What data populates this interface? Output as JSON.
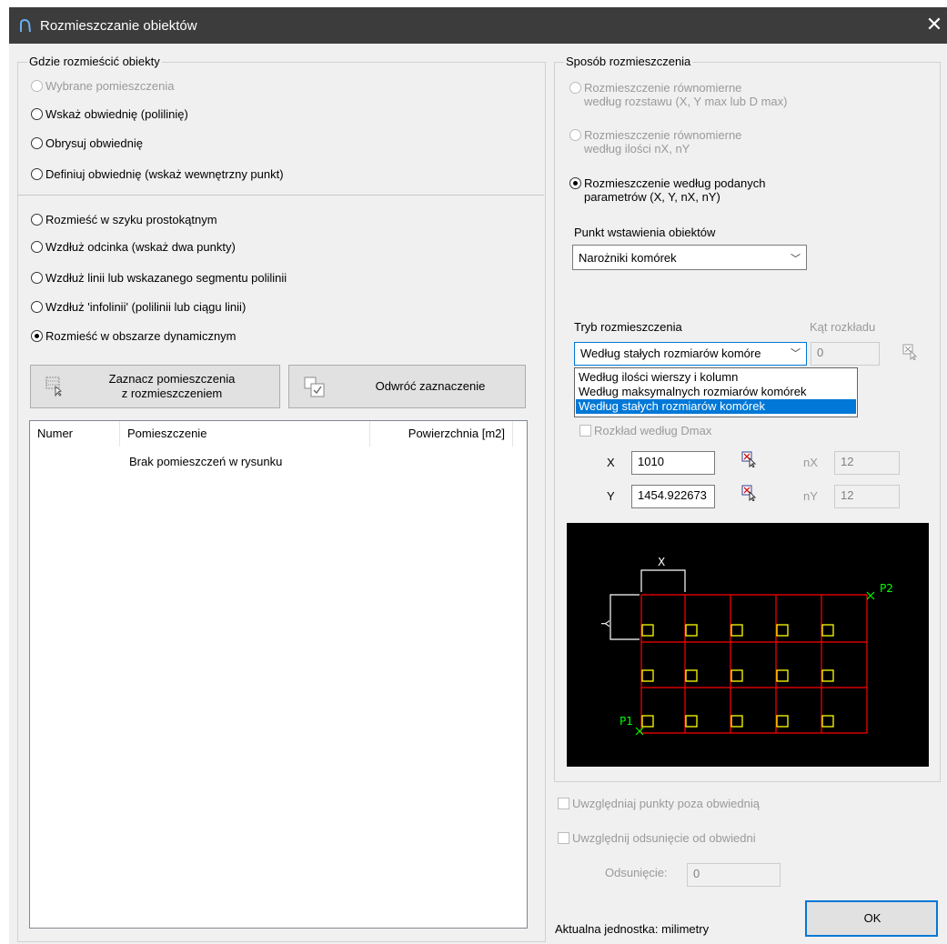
{
  "window": {
    "title": "Rozmieszczanie obiektów",
    "close_glyph": "✕"
  },
  "where": {
    "title": "Gdzie rozmieścić obiekty",
    "options": [
      {
        "label": "Wybrane pomieszczenia",
        "checked": false,
        "enabled": false
      },
      {
        "label": "Wskaż obwiednię (polilinię)",
        "checked": false,
        "enabled": true
      },
      {
        "label": "Obrysuj obwiednię",
        "checked": false,
        "enabled": true
      },
      {
        "label": "Definiuj obwiednię (wskaż wewnętrzny punkt)",
        "checked": false,
        "enabled": true
      }
    ],
    "modes": [
      {
        "label": "Rozmieść w szyku prostokątnym",
        "checked": false
      },
      {
        "label": "Wzdłuż odcinka (wskaż dwa punkty)",
        "checked": false
      },
      {
        "label": "Wzdłuż linii lub wskazanego segmentu polilinii",
        "checked": false
      },
      {
        "label": "Wzdłuż 'infolinii' (polilinii lub ciągu linii)",
        "checked": false
      },
      {
        "label": "Rozmieść w obszarze dynamicznym",
        "checked": true
      }
    ]
  },
  "buttons": {
    "select_rooms_line1": "Zaznacz pomieszczenia",
    "select_rooms_line2": "z rozmieszczeniem",
    "invert_selection": "Odwróć zaznaczenie",
    "ok": "OK"
  },
  "rooms_table": {
    "columns": [
      "Numer",
      "Pomieszczenie",
      "Powierzchnia [m2]"
    ],
    "empty_text": "Brak pomieszczeń w rysunku"
  },
  "method": {
    "title": "Sposób rozmieszczenia",
    "options": [
      {
        "line1": "Rozmieszczenie równomierne",
        "line2": "według rozstawu (X, Y max lub D max)",
        "checked": false,
        "enabled": false
      },
      {
        "line1": "Rozmieszczenie równomierne",
        "line2": "według ilości nX, nY",
        "checked": false,
        "enabled": false
      },
      {
        "line1": "Rozmieszczenie według podanych",
        "line2": "parametrów (X, Y, nX, nY)",
        "checked": true,
        "enabled": true
      }
    ],
    "insert_point_label": "Punkt wstawienia obiektów",
    "insert_point_value": "Narożniki komórek",
    "mode_label": "Tryb rozmieszczenia",
    "mode_value": "Według stałych rozmiarów komóre",
    "angle_label": "Kąt rozkładu",
    "angle_value": "0",
    "mode_options": [
      "Według ilości wierszy i kolumn",
      "Według maksymalnych rozmiarów komórek",
      "Według stałych rozmiarów komórek"
    ],
    "selected_option_index": 2,
    "dmax_label": "Rozkład według Dmax",
    "x_label": "X",
    "x_value": "1010",
    "y_label": "Y",
    "y_value": "1454.922673",
    "nx_label": "nX",
    "nx_value": "12",
    "ny_label": "nY",
    "ny_value": "12"
  },
  "preview": {
    "x_label": "X",
    "y_label": "Y",
    "p1_label": "P1",
    "p2_label": "P2",
    "grid_color": "#ff0000",
    "marker_color": "#ffff00",
    "point_color": "#00ff00"
  },
  "options": {
    "include_outside_points": "Uwzględniaj punkty poza obwiednią",
    "include_offset": "Uwzględnij odsunięcie od obwiedni",
    "offset_label": "Odsunięcie:",
    "offset_value": "0"
  },
  "footer": {
    "unit_text": "Aktualna jednostka: milimetry"
  }
}
